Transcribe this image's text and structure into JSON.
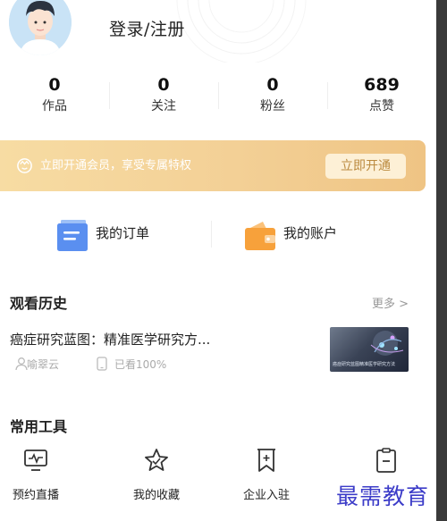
{
  "header": {
    "login_text": "登录/注册"
  },
  "stats": [
    {
      "value": "0",
      "label": "作品"
    },
    {
      "value": "0",
      "label": "关注"
    },
    {
      "value": "0",
      "label": "粉丝"
    },
    {
      "value": "689",
      "label": "点赞"
    }
  ],
  "vip": {
    "text": "立即开通会员，享受专属特权",
    "button": "立即开通"
  },
  "quick": {
    "orders": "我的订单",
    "account": "我的账户"
  },
  "history": {
    "title": "观看历史",
    "more": "更多 >",
    "item": {
      "title": "癌症研究蓝图：精准医学研究方...",
      "author": "喻翠云",
      "progress": "已看100%",
      "thumb_caption": "癌症研究蓝图精准医学研究方法"
    }
  },
  "tools": {
    "title": "常用工具",
    "items": [
      {
        "label": "预约直播",
        "icon": "monitor-pulse-icon"
      },
      {
        "label": "我的收藏",
        "icon": "star-icon"
      },
      {
        "label": "企业入驻",
        "icon": "bookmark-plus-icon"
      },
      {
        "label": "",
        "icon": "clipboard-minus-icon"
      }
    ]
  },
  "watermark": "最需教育",
  "colors": {
    "vip_gradient_start": "#f7dca3",
    "vip_gradient_end": "#efc484",
    "vip_button_text": "#bb8a3f",
    "order_icon": "#5a8ff0",
    "wallet_icon": "#f7a13b",
    "watermark": "#3c3cc8"
  }
}
